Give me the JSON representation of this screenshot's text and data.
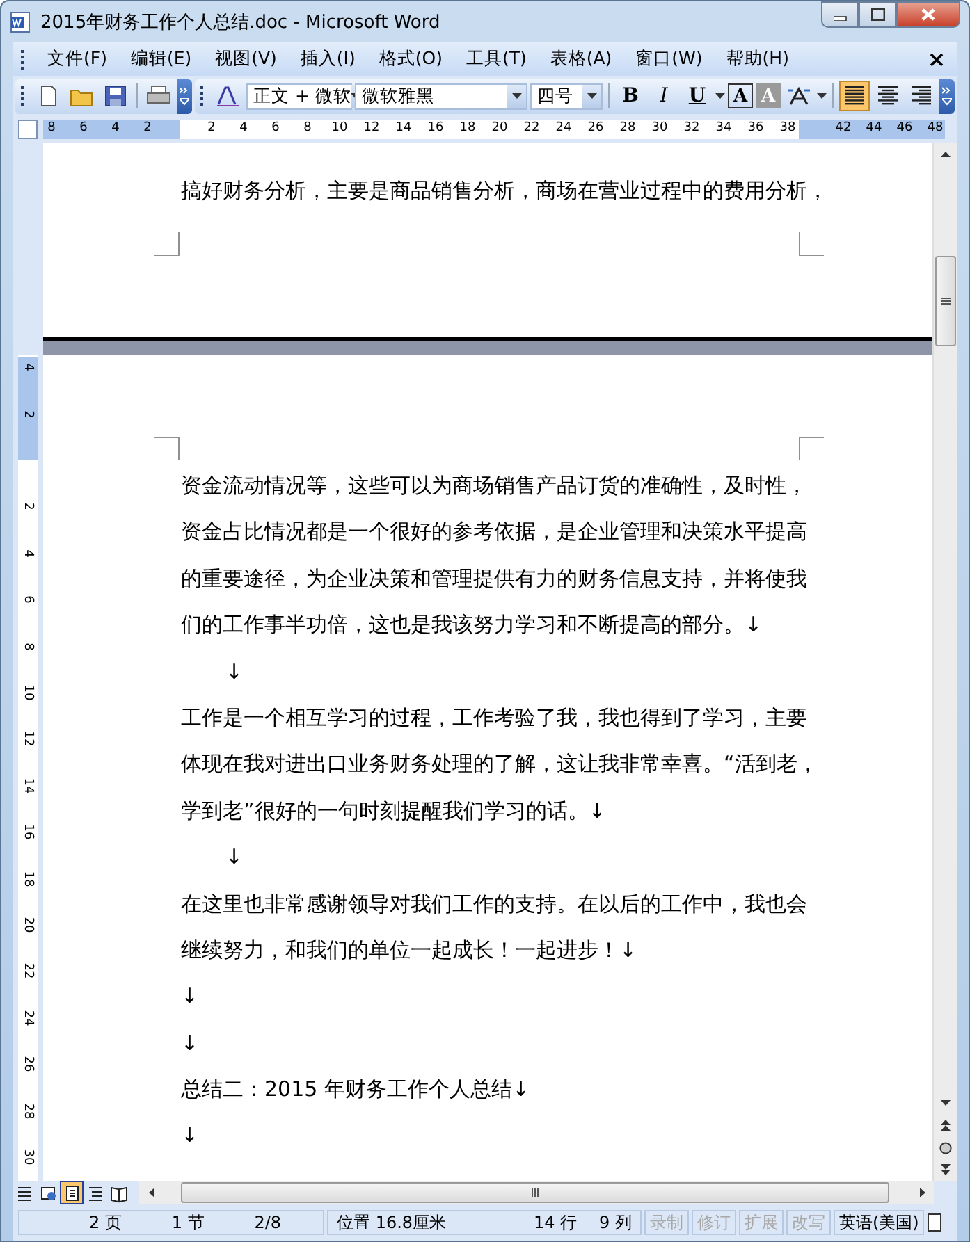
{
  "window": {
    "title": "2015年财务工作个人总结.doc - Microsoft Word"
  },
  "menu": [
    "文件(F)",
    "编辑(E)",
    "视图(V)",
    "插入(I)",
    "格式(O)",
    "工具(T)",
    "表格(A)",
    "窗口(W)",
    "帮助(H)"
  ],
  "toolbar": {
    "style": "正文 + 微软",
    "font": "微软雅黑",
    "size": "四号",
    "format_buttons": [
      {
        "label": "B",
        "kind": "bold"
      },
      {
        "label": "I",
        "kind": "italic"
      },
      {
        "label": "U",
        "kind": "underline"
      }
    ],
    "char_buttons": [
      {
        "label": "A",
        "kind": "border"
      },
      {
        "label": "A",
        "kind": "shade"
      }
    ],
    "align_buttons": [
      {
        "kind": "left",
        "selected": true
      },
      {
        "kind": "center",
        "selected": false
      },
      {
        "kind": "right",
        "selected": false
      }
    ]
  },
  "ruler": {
    "left_labels": [
      "8",
      "6",
      "4",
      "2"
    ],
    "labels": [
      "2",
      "4",
      "6",
      "8",
      "10",
      "12",
      "14",
      "16",
      "18",
      "20",
      "22",
      "24",
      "26",
      "28",
      "30",
      "32",
      "34",
      "36",
      "38"
    ],
    "right_labels": [
      "42",
      "44",
      "46",
      "48"
    ]
  },
  "vertical_ruler": {
    "top_labels": [
      "4",
      "2"
    ],
    "labels": [
      "2",
      "4",
      "6",
      "8",
      "10",
      "12",
      "14",
      "16",
      "18",
      "20",
      "22",
      "24",
      "26",
      "28",
      "30"
    ]
  },
  "page1": [
    {
      "kind": "body",
      "lines": [
        "搞好财务分析，主要是商品销售分析，商场在营业过程中的费用分析，"
      ]
    }
  ],
  "page2": [
    {
      "kind": "body",
      "lines": [
        "资金流动情况等，这些可以为商场销售产品订货的准确性，及时性，",
        "资金占比情况都是一个很好的参考依据，是企业管理和决策水平提高",
        "的重要途径，为企业决策和管理提供有力的财务信息支持，并将使我",
        "们的工作事半功倍，这也是我该努力学习和不断提高的部分。↓"
      ]
    },
    {
      "kind": "indented",
      "lines": [
        "↓"
      ]
    },
    {
      "kind": "body",
      "lines": [
        "工作是一个相互学习的过程，工作考验了我，我也得到了学习，主要",
        "体现在我对进出口业务财务处理的了解，这让我非常幸喜。“活到老，",
        "学到老”很好的一句时刻提醒我们学习的话。↓"
      ]
    },
    {
      "kind": "indented",
      "lines": [
        "↓"
      ]
    },
    {
      "kind": "body",
      "lines": [
        "在这里也非常感谢领导对我们工作的支持。在以后的工作中，我也会",
        "继续努力，和我们的单位一起成长！一起进步！↓"
      ]
    },
    {
      "kind": "body",
      "lines": [
        "↓"
      ]
    },
    {
      "kind": "body",
      "lines": [
        "↓"
      ]
    },
    {
      "kind": "body",
      "lines": [
        "总结二：2015 年财务工作个人总结↓"
      ]
    },
    {
      "kind": "body",
      "lines": [
        "↓"
      ]
    }
  ],
  "view_buttons": [
    {
      "kind": "normal",
      "selected": false
    },
    {
      "kind": "web",
      "selected": false
    },
    {
      "kind": "print",
      "selected": true
    },
    {
      "kind": "outline",
      "selected": false
    },
    {
      "kind": "reading",
      "selected": false
    }
  ],
  "status_bar": {
    "page": "2 页",
    "section": "1 节",
    "pages": "2/8",
    "position": "位置 16.8厘米",
    "line": "14 行",
    "column": "9 列",
    "modes": [
      {
        "label": "录制",
        "disabled": true
      },
      {
        "label": "修订",
        "disabled": true
      },
      {
        "label": "扩展",
        "disabled": true
      },
      {
        "label": "改写",
        "disabled": true
      }
    ],
    "language": "英语(美国)"
  }
}
